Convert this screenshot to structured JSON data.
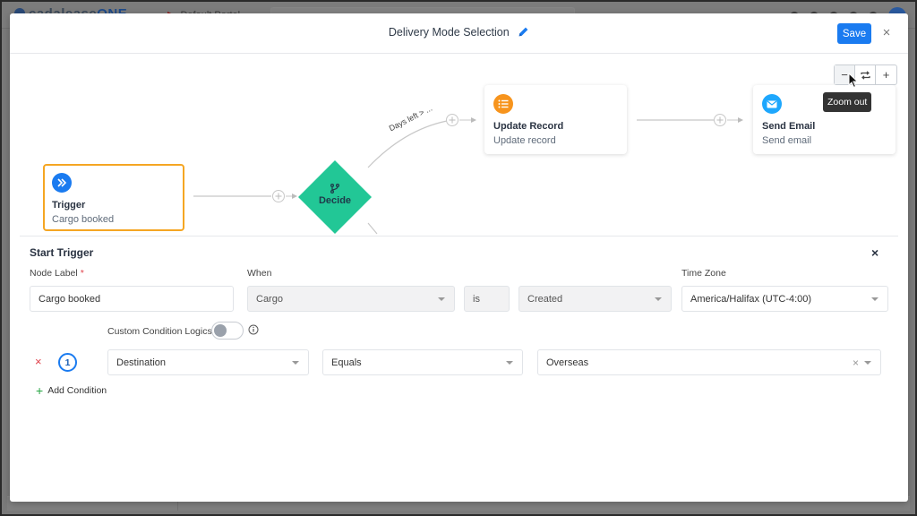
{
  "background_app": {
    "logo_prefix": "cadalease",
    "logo_suffix": "ONE",
    "portal_label": "Default Portal"
  },
  "modal": {
    "title": "Delivery Mode Selection",
    "save_label": "Save",
    "close_symbol": "×"
  },
  "canvas": {
    "zoom_controls": {
      "zoom_out_symbol": "−",
      "reset_symbol": "⇄",
      "zoom_in_symbol": "+",
      "tooltip": "Zoom out"
    },
    "nodes": [
      {
        "id": "trigger",
        "title": "Trigger",
        "subtitle": "Cargo booked",
        "icon": "double-chevron-right-icon",
        "color": "#1a7bf0",
        "selected": true
      },
      {
        "id": "decide",
        "title": "Decide",
        "icon": "branch-icon",
        "color": "#22c796"
      },
      {
        "id": "update",
        "title": "Update Record",
        "subtitle": "Update record",
        "icon": "list-icon",
        "color": "#f7941d"
      },
      {
        "id": "email",
        "title": "Send Email",
        "subtitle": "Send email",
        "icon": "envelope-icon",
        "color": "#1ea7fd"
      }
    ],
    "edge_label": "Days left > ..."
  },
  "panel": {
    "title": "Start Trigger",
    "close_symbol": "×",
    "node_label": {
      "label": "Node Label",
      "required_mark": "*",
      "value": "Cargo booked"
    },
    "when": {
      "label": "When",
      "entity": "Cargo",
      "operator": "is",
      "event": "Created"
    },
    "time_zone": {
      "label": "Time Zone",
      "value": "America/Halifax (UTC-4:00)"
    },
    "custom_condition": {
      "label": "Custom Condition Logics",
      "enabled": false
    },
    "conditions": [
      {
        "number": "1",
        "field": "Destination",
        "operator": "Equals",
        "value": "Overseas"
      }
    ],
    "remove_symbol": "×",
    "add_condition_label": "Add Condition",
    "add_symbol": "+"
  },
  "colors": {
    "primary": "#1a7bf0",
    "trigger_border": "#f5a623",
    "decide": "#22c796",
    "update_icon": "#f7941d",
    "email_icon": "#1ea7fd",
    "danger": "#e0424b",
    "success": "#28a745"
  }
}
